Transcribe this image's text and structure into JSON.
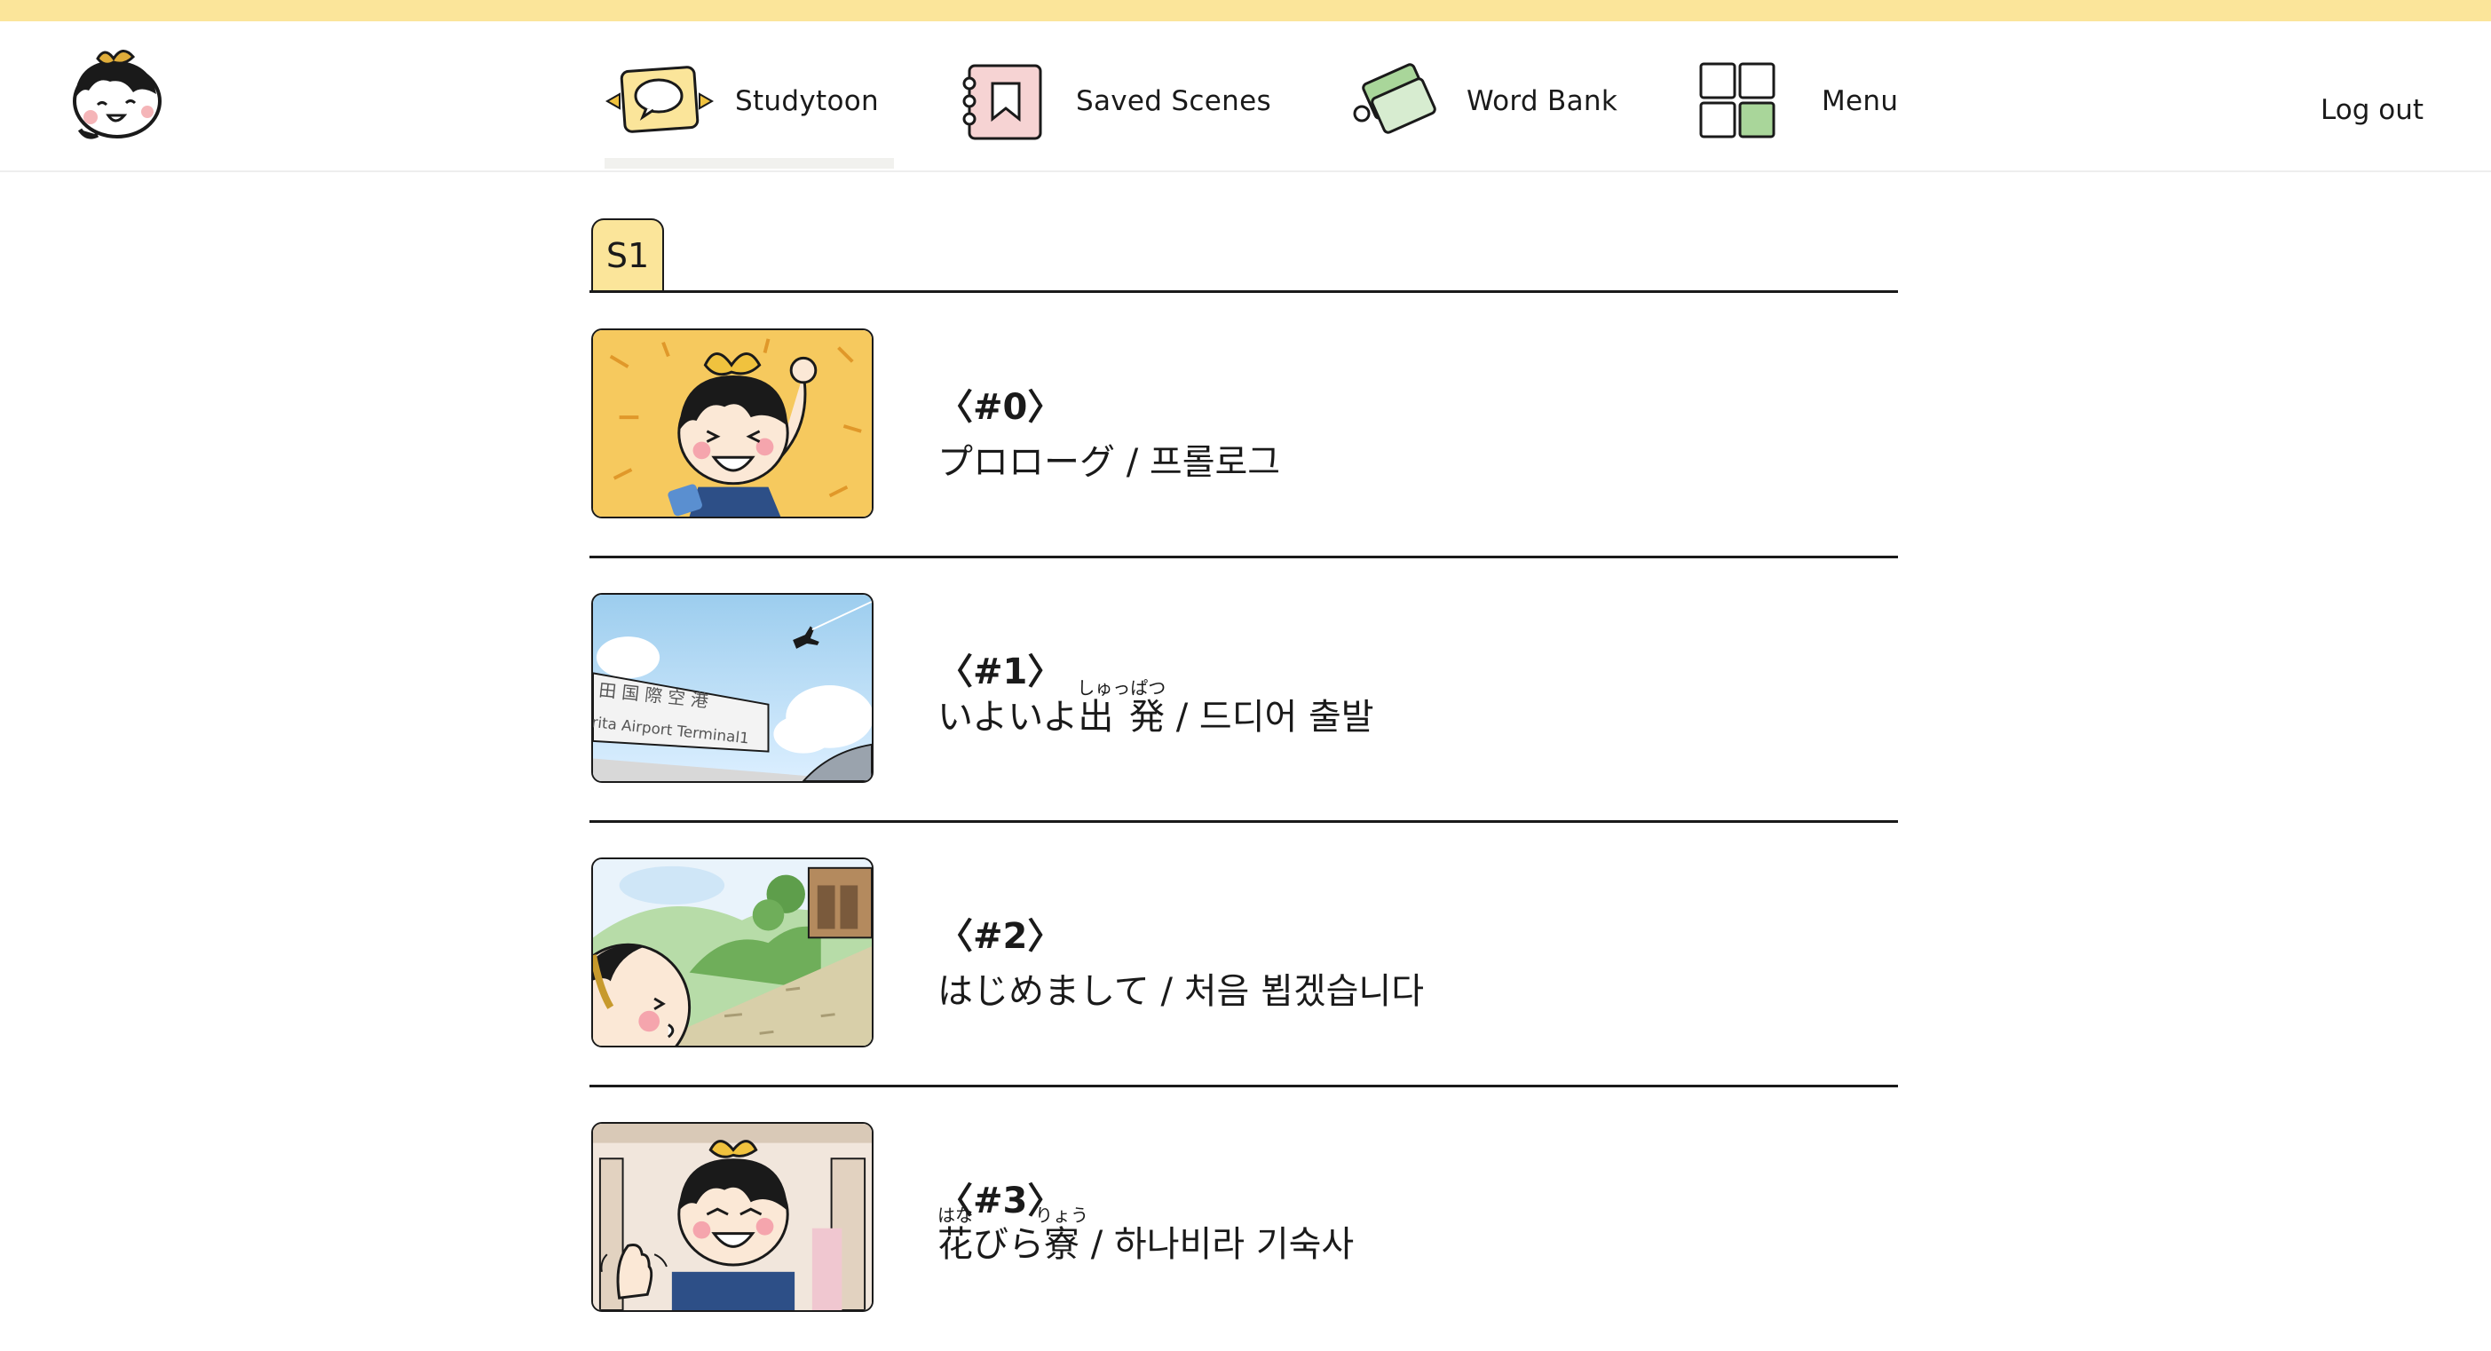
{
  "nav": {
    "items": [
      {
        "label": "Studytoon",
        "icon": "speech-bubble-icon"
      },
      {
        "label": "Saved Scenes",
        "icon": "bookmark-notebook-icon"
      },
      {
        "label": "Word Bank",
        "icon": "flashcards-icon"
      },
      {
        "label": "Menu",
        "icon": "grid-menu-icon"
      }
    ],
    "active": "Studytoon",
    "logout_label": "Log out"
  },
  "season_tab": "S1",
  "episodes": [
    {
      "number": "〈#0〉",
      "title": "プロローグ / 프롤로그"
    },
    {
      "number": "〈#1〉",
      "title_prefix": "いよいよ",
      "ruby_base": "出 発",
      "ruby_text": "しゅっぱつ",
      "title_suffix": " / 드디어 출발"
    },
    {
      "number": "〈#2〉",
      "title": "はじめまして / 처음 뵙겠습니다"
    },
    {
      "number": "〈#3〉",
      "ruby_base": "花",
      "ruby_text": "はな",
      "title_middle": "びら",
      "ruby_base_2": "寮",
      "ruby_text_2": "りょう",
      "title_suffix": " / 하나비라 기숙사"
    }
  ],
  "thumbnail_text": {
    "sign_line1": "田 国 際 空 港",
    "sign_line2": "rita Airport Terminal1"
  },
  "colors": {
    "accent_yellow": "#fbe59a",
    "thumb0_bg": "#f6c95e",
    "sky_blue": "#bfe0f5",
    "hill_green": "#a9d69a"
  }
}
